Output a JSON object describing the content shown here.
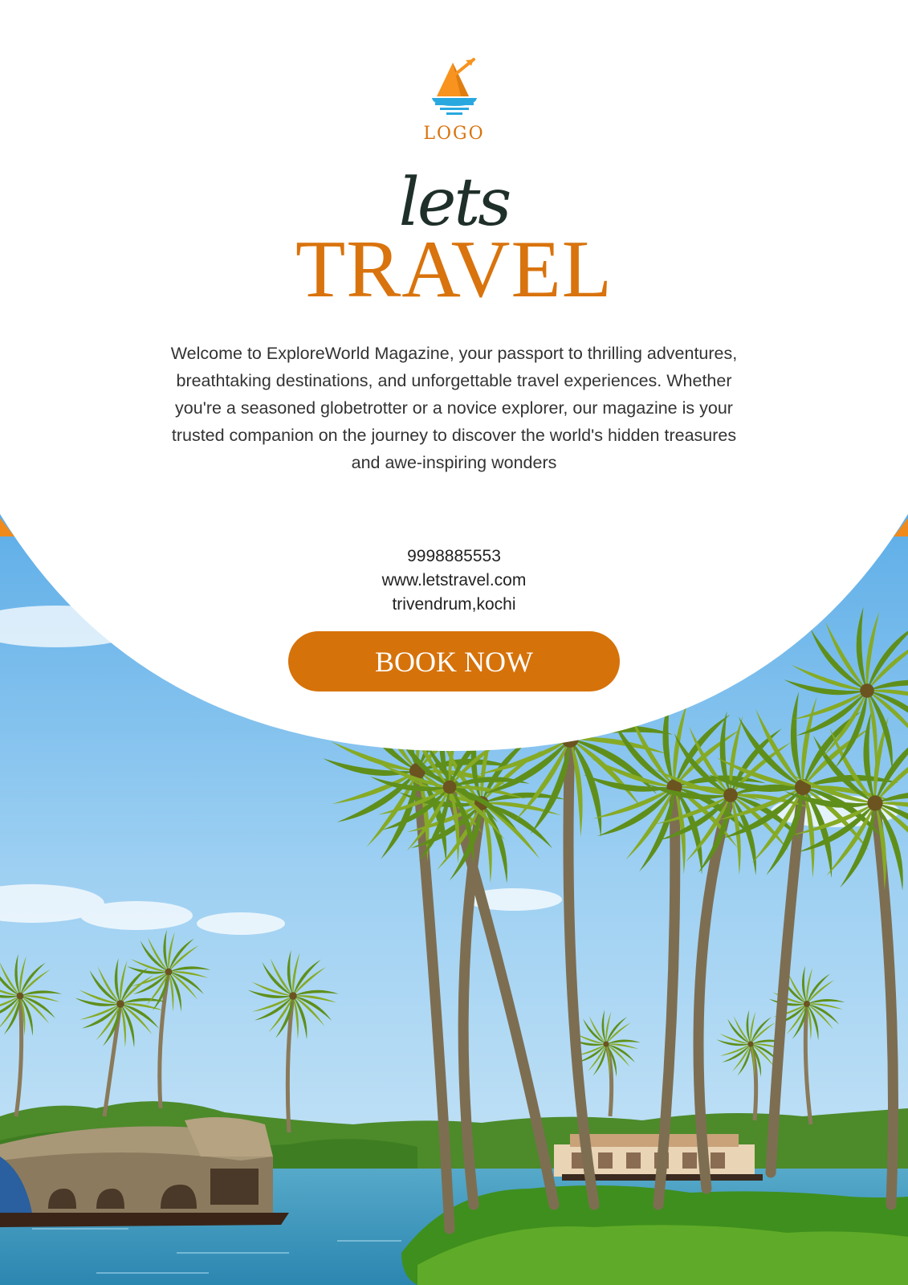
{
  "brand": {
    "logo_text": "LOGO",
    "accent_color": "#d9730d",
    "logo_sail_color": "#f7931e",
    "logo_water_color": "#29a8e0"
  },
  "headline": {
    "script_word": "lets",
    "main_word": "TRAVEL"
  },
  "intro": "Welcome to ExploreWorld Magazine, your passport to thrilling adventures, breathtaking destinations, and unforgettable travel experiences. Whether you're a seasoned globetrotter or a novice explorer, our magazine is your trusted companion on the journey to discover the world's hidden treasures and awe-inspiring wonders",
  "contact": {
    "phone": "9998885553",
    "website": "www.letstravel.com",
    "location": "trivendrum,kochi"
  },
  "cta": {
    "label": "BOOK NOW",
    "color": "#d6720a"
  },
  "photo": {
    "subject": "Kerala backwaters with coconut palms and houseboats"
  }
}
